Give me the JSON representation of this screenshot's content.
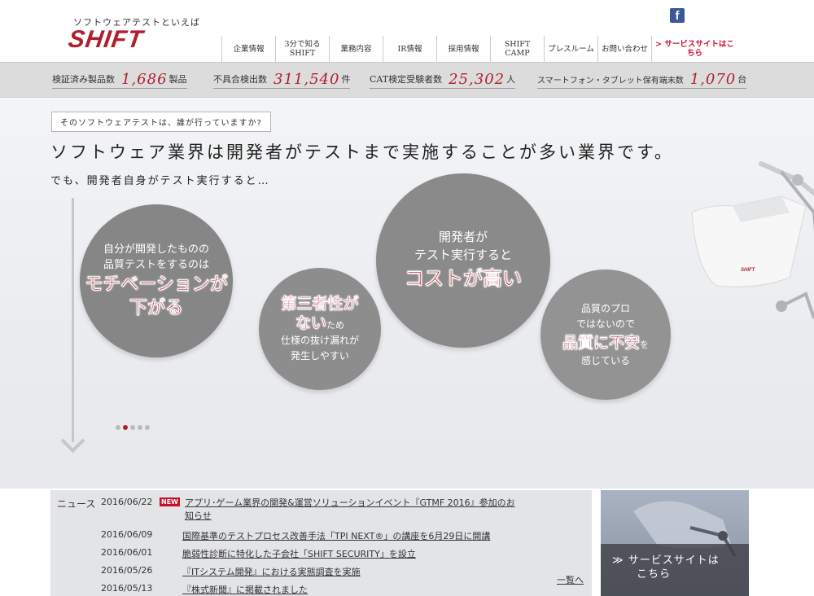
{
  "header": {
    "tagline": "ソフトウェアテストといえば",
    "logo": "SHIFT",
    "facebook_glyph": "f",
    "nav": [
      {
        "label": "企業情報",
        "w": 66
      },
      {
        "label": "3分で知る\nSHIFT",
        "w": 66
      },
      {
        "label": "業務内容",
        "w": 66
      },
      {
        "label": "IR情報",
        "w": 66
      },
      {
        "label": "採用情報",
        "w": 66
      },
      {
        "label": "SHIFT\nCAMP",
        "w": 66
      },
      {
        "label": "プレスルーム",
        "w": 66
      },
      {
        "label": "お問い合わせ",
        "w": 66
      },
      {
        "label": "> サービスサイトはこちら",
        "w": 106
      }
    ]
  },
  "stats": [
    {
      "label": "検証済み製品数",
      "value": "1,686",
      "unit": "製品"
    },
    {
      "label": "不具合検出数",
      "value": "311,540",
      "unit": "件"
    },
    {
      "label": "CAT検定受験者数",
      "value": "25,302",
      "unit": "人"
    },
    {
      "label": "スマートフォン・タブレット保有端末数",
      "value": "1,070",
      "unit": "台"
    }
  ],
  "hero": {
    "question": "そのソフトウェアテストは、誰が行っていますか?",
    "headline": "ソフトウェア業界は開発者がテストまで実施することが多い業界です。",
    "subline": "でも、開発者自身がテスト実行すると…",
    "circle1": {
      "l1": "自分が開発したものの",
      "l2": "品質テストをするのは",
      "b1": "モチベーションが",
      "b2": "下がる"
    },
    "circle2": {
      "b1": "第三者性が",
      "b2": "ない",
      "s1": "ため",
      "l1": "仕様の抜け漏れが",
      "l2": "発生しやすい"
    },
    "circle3": {
      "l1": "開発者が",
      "l2": "テスト実行すると",
      "b1": "コストが高い"
    },
    "circle4": {
      "l1": "品質のプロ",
      "l2": "ではないので",
      "b1": "品質に不安",
      "s1": "を",
      "l3": "感じている"
    },
    "slider_total": 5,
    "slider_active": 2
  },
  "news": {
    "label": "ニュース",
    "new_badge": "NEW",
    "items": [
      {
        "date": "2016/06/22",
        "title": "アプリ･ゲーム業界の開発&運営ソリューションイベント『GTMF 2016』参加のお",
        "title2": "知らせ",
        "is_new": true
      },
      {
        "date": "2016/06/09",
        "title": "国際基準のテストプロセス改善手法「TPI NEXT®」の講座を6月29日に開講"
      },
      {
        "date": "2016/06/01",
        "title": "脆弱性診断に特化した子会社「SHIFT SECURITY」を設立"
      },
      {
        "date": "2016/05/26",
        "title": "『ITシステム開発』における実態調査を実施"
      },
      {
        "date": "2016/05/13",
        "title": "『株式新聞』に掲載されました"
      }
    ],
    "more": "一覧へ"
  },
  "service_banner": {
    "line1": "≫ サービスサイトは",
    "line2": "こちら"
  },
  "colors": {
    "brand_red": "#b01e2e",
    "stats_bg": "#dcdcdc",
    "circle_gray": "#888888"
  }
}
